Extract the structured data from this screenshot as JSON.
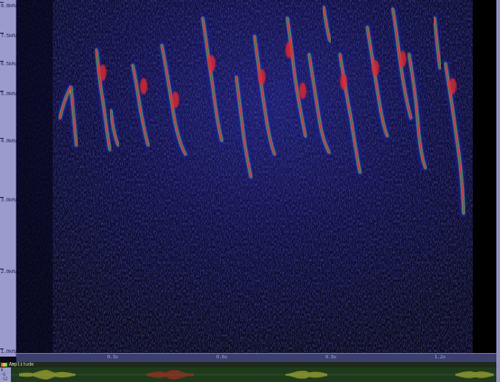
{
  "freq_ruler": {
    "ticks": [
      "8.8kHz",
      "7.5kHz",
      "6.5kHz",
      "5.0kHz",
      "4.0kHz",
      "3.0kHz",
      "2.0kHz",
      "1.0kHz"
    ]
  },
  "time_axis": {
    "ticks": [
      "0.3s",
      "0.6s",
      "0.9s",
      "1.2s"
    ]
  },
  "amplitude": {
    "label": "Amplitude",
    "ruler": [
      "0",
      "-6",
      "-12"
    ]
  },
  "colors": {
    "background": "#0a0a18",
    "low": "#1a1ab0",
    "mid": "#3fe06a",
    "high": "#e8262a",
    "peak": "#f2e33a"
  }
}
